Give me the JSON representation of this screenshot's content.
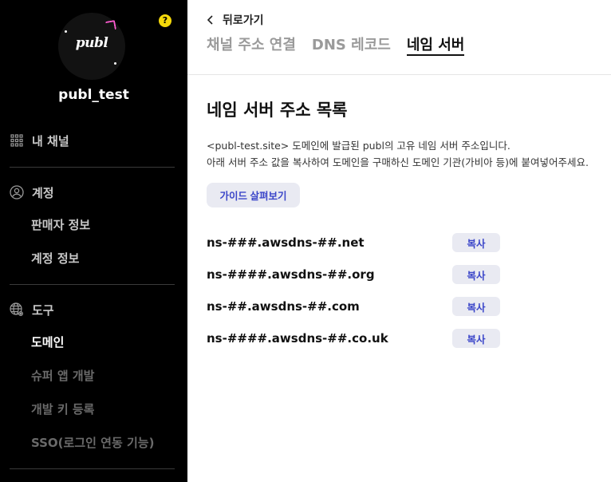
{
  "sidebar": {
    "avatar_text": "publ",
    "help_badge": "?",
    "username": "publ_test",
    "my_channel": "내 채널",
    "account_section": "계정",
    "account_items": [
      "판매자 정보",
      "계정 정보"
    ],
    "tools_section": "도구",
    "tools_items": [
      "도메인",
      "슈퍼 앱 개발",
      "개발 키 등록",
      "SSO(로그인 연동 기능)"
    ]
  },
  "header": {
    "back_label": "뒤로가기",
    "tabs": [
      "채널 주소 연결",
      "DNS 레코드",
      "네임 서버"
    ],
    "active_tab": "네임 서버"
  },
  "main": {
    "title": "네임 서버 주소 목록",
    "desc_line1": "<publ-test.site> 도메인에 발급된 publ의 고유 네임 서버 주소입니다.",
    "desc_line2": "아래 서버 주소 값을 복사하여 도메인을 구매하신 도메인 기관(가비아 등)에 붙여넣어주세요.",
    "guide_button": "가이드 살펴보기",
    "copy_label": "복사",
    "nameservers": [
      "ns-###.awsdns-##.net",
      "ns-####.awsdns-##.org",
      "ns-##.awsdns-##.com",
      "ns-####.awsdns-##.co.uk"
    ]
  },
  "colors": {
    "sidebar_bg": "#000000",
    "accent_text": "#3b46c9",
    "button_bg": "#e9eaf2",
    "help_badge": "#f5d90a"
  }
}
